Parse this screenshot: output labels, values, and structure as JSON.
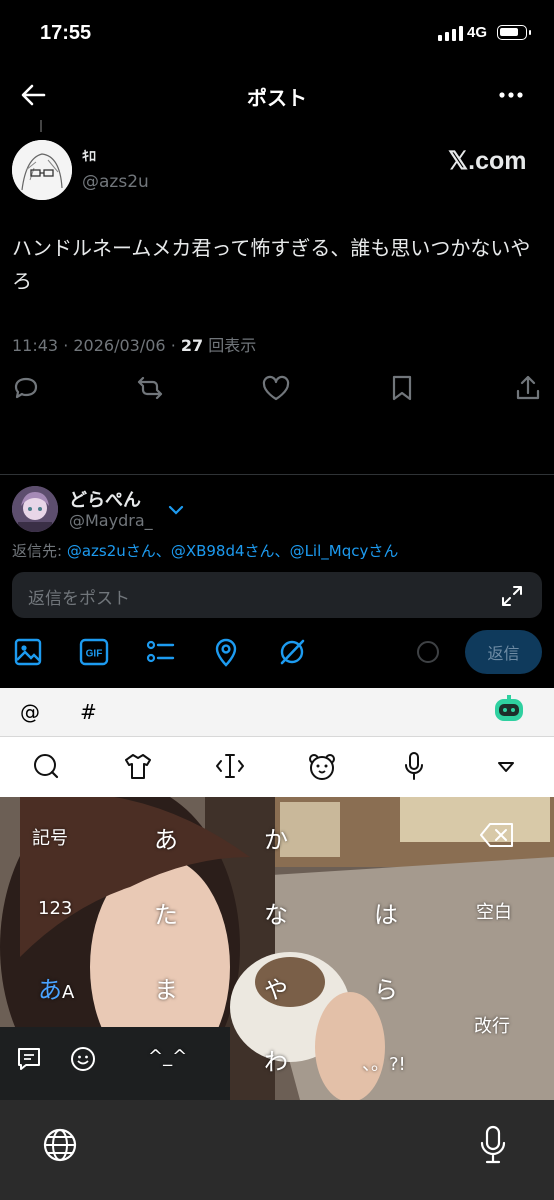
{
  "status_bar": {
    "time": "17:55",
    "network": "4G"
  },
  "nav": {
    "title": "ポスト"
  },
  "post": {
    "author_name": "ｷﾛ",
    "author_handle": "@azs2u",
    "brand": "𝕏.com",
    "text": "ハンドルネームメカ君って怖すぎる、誰も思いつかないやろ",
    "time": "11:43",
    "date": "2026/03/06",
    "views_count": "27",
    "views_label": "回表示"
  },
  "reply": {
    "name": "どらぺん",
    "handle": "@Maydra_",
    "reply_to_label": "返信先:",
    "reply_to_users": [
      "@azs2u",
      "@XB98d4",
      "@Lil_Mqcy"
    ],
    "reply_to_suffix": "さん",
    "reply_to_separator": "、",
    "placeholder": "返信をポスト",
    "button": "返信"
  },
  "keyboard": {
    "top_keys": [
      "@",
      "#"
    ],
    "keys": {
      "symbols": "記号",
      "a": "あ",
      "ka": "か",
      "num": "123",
      "ta": "た",
      "na": "な",
      "ha": "は",
      "space": "空白",
      "mode_a": "あ",
      "mode_b": "A",
      "ma": "ま",
      "ya": "や",
      "ra": "ら",
      "enter": "改行",
      "kaomoji": "^_^",
      "wa": "わ",
      "punct": "、。?!"
    }
  },
  "colors": {
    "accent": "#1d9bf0",
    "background": "#000000",
    "muted": "#71767b"
  }
}
